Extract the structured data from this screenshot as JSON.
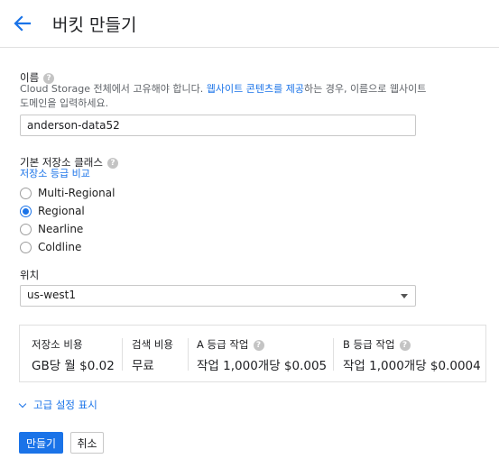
{
  "header": {
    "title": "버킷 만들기"
  },
  "name_field": {
    "label": "이름",
    "description_pre": "Cloud Storage 전체에서 고유해야 합니다. ",
    "description_link": "웹사이트 콘텐츠를 제공",
    "description_post": "하는 경우, 이름으로 웹사이트 도메인을 입력하세요.",
    "value": "anderson-data52"
  },
  "storage_class": {
    "label": "기본 저장소 클래스",
    "compare_link": "저장소 등급 비교",
    "options": [
      "Multi-Regional",
      "Regional",
      "Nearline",
      "Coldline"
    ],
    "selected": "Regional"
  },
  "location": {
    "label": "위치",
    "selected": "us-west1"
  },
  "pricing": [
    {
      "header": "저장소 비용",
      "value": "GB당 월 $0.02",
      "help": false
    },
    {
      "header": "검색 비용",
      "value": "무료",
      "help": false
    },
    {
      "header": "A 등급 작업",
      "value": "작업 1,000개당 $0.005",
      "help": true
    },
    {
      "header": "B 등급 작업",
      "value": "작업 1,000개당 $0.0004",
      "help": true
    }
  ],
  "advanced_link": "고급 설정 표시",
  "buttons": {
    "create": "만들기",
    "cancel": "취소"
  },
  "help_glyph": "?",
  "colors": {
    "accent": "#1a73e8",
    "help_icon": "#c4c4c4"
  },
  "icons": [
    "back-arrow-icon",
    "help-icon",
    "dropdown-caret-icon",
    "chevron-down-icon"
  ]
}
